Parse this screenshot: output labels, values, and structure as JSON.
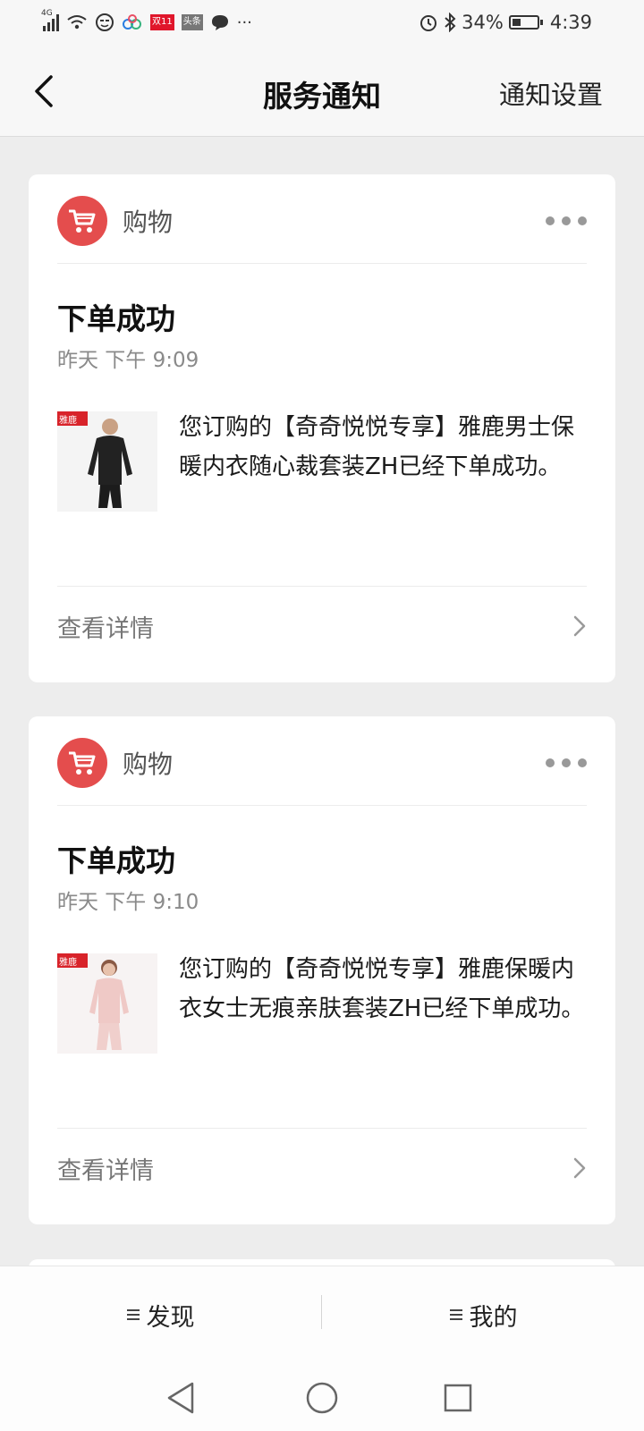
{
  "status_bar": {
    "network": "4G",
    "badge1": "双11",
    "badge2": "头条",
    "more": "···",
    "battery": "34%",
    "battery_level": 0.34,
    "time": "4:39"
  },
  "nav": {
    "title": "服务通知",
    "settings_label": "通知设置"
  },
  "cards": [
    {
      "source": "购物",
      "title": "下单成功",
      "time": "昨天 下午 9:09",
      "body": "您订购的【奇奇悦悦专享】雅鹿男士保暖内衣随心裁套装ZH已经下单成功。",
      "detail_label": "查看详情",
      "brand_logo": "雅鹿",
      "thumb_icon": "man-thermal-underwear-photo"
    },
    {
      "source": "购物",
      "title": "下单成功",
      "time": "昨天 下午 9:10",
      "body": "您订购的【奇奇悦悦专享】雅鹿保暖内衣女士无痕亲肤套装ZH已经下单成功。",
      "detail_label": "查看详情",
      "brand_logo": "雅鹿",
      "thumb_icon": "woman-thermal-underwear-photo"
    }
  ],
  "bottom_menu": {
    "left_label": "发现",
    "right_label": "我的"
  },
  "colors": {
    "accent_red": "#e44d4d",
    "page_bg": "#ededed",
    "card_bg": "#ffffff"
  }
}
